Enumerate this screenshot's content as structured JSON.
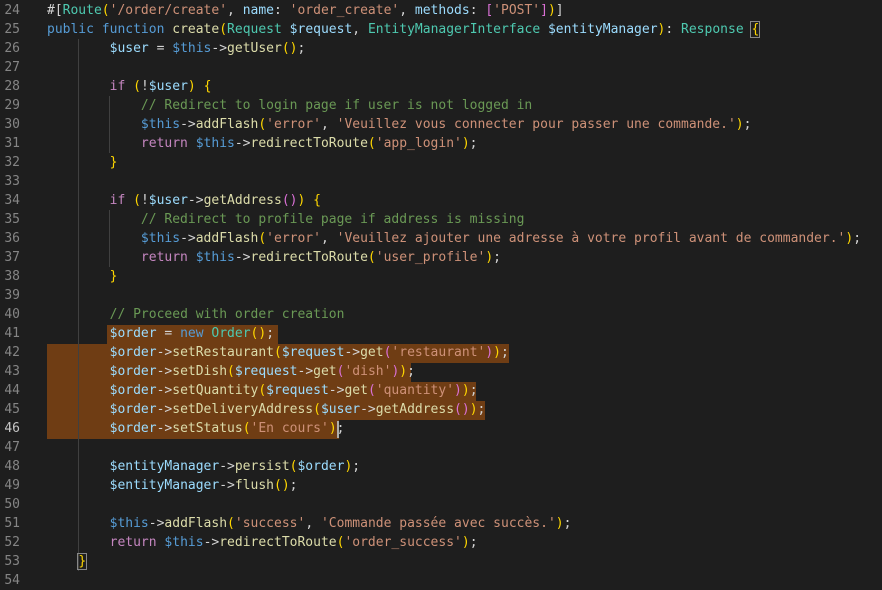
{
  "editor": {
    "active_line": "46",
    "lines": [
      {
        "number": "24",
        "tokens": [
          [
            "p",
            "#["
          ],
          [
            "t",
            "Route"
          ],
          [
            "y",
            "("
          ],
          [
            "s",
            "'/order/create'"
          ],
          [
            "p",
            ", "
          ],
          [
            "v",
            "name"
          ],
          [
            "p",
            ": "
          ],
          [
            "s",
            "'order_create'"
          ],
          [
            "p",
            ", "
          ],
          [
            "v",
            "methods"
          ],
          [
            "p",
            ": "
          ],
          [
            "m",
            "["
          ],
          [
            "s",
            "'POST'"
          ],
          [
            "m",
            "]"
          ],
          [
            "y",
            ")"
          ],
          [
            "p",
            "]"
          ]
        ]
      },
      {
        "number": "25",
        "tokens": [
          [
            "k",
            "public"
          ],
          [
            "p",
            " "
          ],
          [
            "k",
            "function"
          ],
          [
            "p",
            " "
          ],
          [
            "f",
            "create"
          ],
          [
            "y",
            "("
          ],
          [
            "t",
            "Request"
          ],
          [
            "p",
            " "
          ],
          [
            "v",
            "$request"
          ],
          [
            "p",
            ", "
          ],
          [
            "t",
            "EntityManagerInterface"
          ],
          [
            "p",
            " "
          ],
          [
            "v",
            "$entityManager"
          ],
          [
            "y",
            ")"
          ],
          [
            "p",
            ": "
          ],
          [
            "t",
            "Response"
          ],
          [
            "p",
            " "
          ],
          [
            "y",
            "{"
          ]
        ]
      },
      {
        "number": "26",
        "tokens": [
          [
            "p",
            "        "
          ],
          [
            "v",
            "$user"
          ],
          [
            "p",
            " = "
          ],
          [
            "k",
            "$this"
          ],
          [
            "p",
            "->"
          ],
          [
            "f",
            "getUser"
          ],
          [
            "y",
            "()"
          ],
          [
            "p",
            ";"
          ]
        ]
      },
      {
        "number": "27",
        "tokens": []
      },
      {
        "number": "28",
        "tokens": [
          [
            "p",
            "        "
          ],
          [
            "c",
            "if"
          ],
          [
            "p",
            " "
          ],
          [
            "y",
            "("
          ],
          [
            "p",
            "!"
          ],
          [
            "v",
            "$user"
          ],
          [
            "y",
            ")"
          ],
          [
            "p",
            " "
          ],
          [
            "y",
            "{"
          ]
        ]
      },
      {
        "number": "29",
        "tokens": [
          [
            "p",
            "            "
          ],
          [
            "cm",
            "// Redirect to login page if user is not logged in"
          ]
        ]
      },
      {
        "number": "30",
        "tokens": [
          [
            "p",
            "            "
          ],
          [
            "k",
            "$this"
          ],
          [
            "p",
            "->"
          ],
          [
            "f",
            "addFlash"
          ],
          [
            "y",
            "("
          ],
          [
            "s",
            "'error'"
          ],
          [
            "p",
            ", "
          ],
          [
            "s",
            "'Veuillez vous connecter pour passer une commande.'"
          ],
          [
            "y",
            ")"
          ],
          [
            "p",
            ";"
          ]
        ]
      },
      {
        "number": "31",
        "tokens": [
          [
            "p",
            "            "
          ],
          [
            "c",
            "return"
          ],
          [
            "p",
            " "
          ],
          [
            "k",
            "$this"
          ],
          [
            "p",
            "->"
          ],
          [
            "f",
            "redirectToRoute"
          ],
          [
            "y",
            "("
          ],
          [
            "s",
            "'app_login'"
          ],
          [
            "y",
            ")"
          ],
          [
            "p",
            ";"
          ]
        ]
      },
      {
        "number": "32",
        "tokens": [
          [
            "p",
            "        "
          ],
          [
            "y",
            "}"
          ]
        ]
      },
      {
        "number": "33",
        "tokens": []
      },
      {
        "number": "34",
        "tokens": [
          [
            "p",
            "        "
          ],
          [
            "c",
            "if"
          ],
          [
            "p",
            " "
          ],
          [
            "y",
            "("
          ],
          [
            "p",
            "!"
          ],
          [
            "v",
            "$user"
          ],
          [
            "p",
            "->"
          ],
          [
            "f",
            "getAddress"
          ],
          [
            "m",
            "()"
          ],
          [
            "y",
            ")"
          ],
          [
            "p",
            " "
          ],
          [
            "y",
            "{"
          ]
        ]
      },
      {
        "number": "35",
        "tokens": [
          [
            "p",
            "            "
          ],
          [
            "cm",
            "// Redirect to profile page if address is missing"
          ]
        ]
      },
      {
        "number": "36",
        "tokens": [
          [
            "p",
            "            "
          ],
          [
            "k",
            "$this"
          ],
          [
            "p",
            "->"
          ],
          [
            "f",
            "addFlash"
          ],
          [
            "y",
            "("
          ],
          [
            "s",
            "'error'"
          ],
          [
            "p",
            ", "
          ],
          [
            "s",
            "'Veuillez ajouter une adresse à votre profil avant de commander.'"
          ],
          [
            "y",
            ")"
          ],
          [
            "p",
            ";"
          ]
        ]
      },
      {
        "number": "37",
        "tokens": [
          [
            "p",
            "            "
          ],
          [
            "c",
            "return"
          ],
          [
            "p",
            " "
          ],
          [
            "k",
            "$this"
          ],
          [
            "p",
            "->"
          ],
          [
            "f",
            "redirectToRoute"
          ],
          [
            "y",
            "("
          ],
          [
            "s",
            "'user_profile'"
          ],
          [
            "y",
            ")"
          ],
          [
            "p",
            ";"
          ]
        ]
      },
      {
        "number": "38",
        "tokens": [
          [
            "p",
            "        "
          ],
          [
            "y",
            "}"
          ]
        ]
      },
      {
        "number": "39",
        "tokens": []
      },
      {
        "number": "40",
        "tokens": [
          [
            "p",
            "        "
          ],
          [
            "cm",
            "// Proceed with order creation"
          ]
        ]
      },
      {
        "number": "41",
        "tokens": [
          [
            "p",
            "        "
          ],
          [
            "v",
            "$order"
          ],
          [
            "p",
            " = "
          ],
          [
            "k",
            "new"
          ],
          [
            "p",
            " "
          ],
          [
            "t",
            "Order"
          ],
          [
            "y",
            "()"
          ],
          [
            "p",
            ";"
          ]
        ]
      },
      {
        "number": "42",
        "tokens": [
          [
            "p",
            "        "
          ],
          [
            "v",
            "$order"
          ],
          [
            "p",
            "->"
          ],
          [
            "f",
            "setRestaurant"
          ],
          [
            "y",
            "("
          ],
          [
            "v",
            "$request"
          ],
          [
            "p",
            "->"
          ],
          [
            "f",
            "get"
          ],
          [
            "m",
            "("
          ],
          [
            "s",
            "'restaurant'"
          ],
          [
            "m",
            ")"
          ],
          [
            "y",
            ")"
          ],
          [
            "p",
            ";"
          ]
        ]
      },
      {
        "number": "43",
        "tokens": [
          [
            "p",
            "        "
          ],
          [
            "v",
            "$order"
          ],
          [
            "p",
            "->"
          ],
          [
            "f",
            "setDish"
          ],
          [
            "y",
            "("
          ],
          [
            "v",
            "$request"
          ],
          [
            "p",
            "->"
          ],
          [
            "f",
            "get"
          ],
          [
            "m",
            "("
          ],
          [
            "s",
            "'dish'"
          ],
          [
            "m",
            ")"
          ],
          [
            "y",
            ")"
          ],
          [
            "p",
            ";"
          ]
        ]
      },
      {
        "number": "44",
        "tokens": [
          [
            "p",
            "        "
          ],
          [
            "v",
            "$order"
          ],
          [
            "p",
            "->"
          ],
          [
            "f",
            "setQuantity"
          ],
          [
            "y",
            "("
          ],
          [
            "v",
            "$request"
          ],
          [
            "p",
            "->"
          ],
          [
            "f",
            "get"
          ],
          [
            "m",
            "("
          ],
          [
            "s",
            "'quantity'"
          ],
          [
            "m",
            ")"
          ],
          [
            "y",
            ")"
          ],
          [
            "p",
            ";"
          ]
        ]
      },
      {
        "number": "45",
        "tokens": [
          [
            "p",
            "        "
          ],
          [
            "v",
            "$order"
          ],
          [
            "p",
            "->"
          ],
          [
            "f",
            "setDeliveryAddress"
          ],
          [
            "y",
            "("
          ],
          [
            "v",
            "$user"
          ],
          [
            "p",
            "->"
          ],
          [
            "f",
            "getAddress"
          ],
          [
            "m",
            "()"
          ],
          [
            "y",
            ")"
          ],
          [
            "p",
            ";"
          ]
        ]
      },
      {
        "number": "46",
        "tokens": [
          [
            "p",
            "        "
          ],
          [
            "v",
            "$order"
          ],
          [
            "p",
            "->"
          ],
          [
            "f",
            "setStatus"
          ],
          [
            "y",
            "("
          ],
          [
            "s",
            "'En cours'"
          ],
          [
            "y",
            ")"
          ],
          [
            "p",
            ";"
          ]
        ]
      },
      {
        "number": "47",
        "tokens": []
      },
      {
        "number": "48",
        "tokens": [
          [
            "p",
            "        "
          ],
          [
            "v",
            "$entityManager"
          ],
          [
            "p",
            "->"
          ],
          [
            "f",
            "persist"
          ],
          [
            "y",
            "("
          ],
          [
            "v",
            "$order"
          ],
          [
            "y",
            ")"
          ],
          [
            "p",
            ";"
          ]
        ]
      },
      {
        "number": "49",
        "tokens": [
          [
            "p",
            "        "
          ],
          [
            "v",
            "$entityManager"
          ],
          [
            "p",
            "->"
          ],
          [
            "f",
            "flush"
          ],
          [
            "y",
            "()"
          ],
          [
            "p",
            ";"
          ]
        ]
      },
      {
        "number": "50",
        "tokens": []
      },
      {
        "number": "51",
        "tokens": [
          [
            "p",
            "        "
          ],
          [
            "k",
            "$this"
          ],
          [
            "p",
            "->"
          ],
          [
            "f",
            "addFlash"
          ],
          [
            "y",
            "("
          ],
          [
            "s",
            "'success'"
          ],
          [
            "p",
            ", "
          ],
          [
            "s",
            "'Commande passée avec succès.'"
          ],
          [
            "y",
            ")"
          ],
          [
            "p",
            ";"
          ]
        ]
      },
      {
        "number": "52",
        "tokens": [
          [
            "p",
            "        "
          ],
          [
            "c",
            "return"
          ],
          [
            "p",
            " "
          ],
          [
            "k",
            "$this"
          ],
          [
            "p",
            "->"
          ],
          [
            "f",
            "redirectToRoute"
          ],
          [
            "y",
            "("
          ],
          [
            "s",
            "'order_success'"
          ],
          [
            "y",
            ")"
          ],
          [
            "p",
            ";"
          ]
        ]
      },
      {
        "number": "53",
        "tokens": [
          [
            "p",
            "    "
          ],
          [
            "y",
            "}"
          ]
        ]
      },
      {
        "number": "54",
        "tokens": []
      }
    ]
  }
}
